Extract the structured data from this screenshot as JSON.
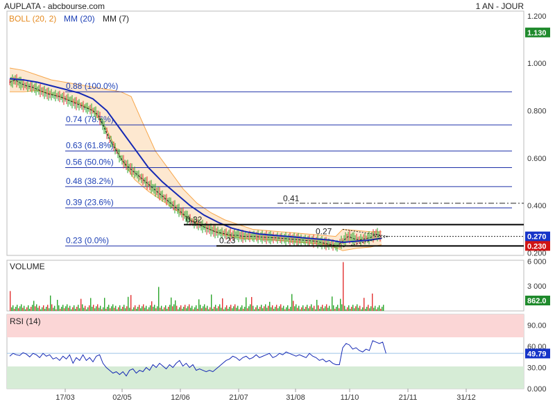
{
  "header": {
    "title": "AUPLATA - abcbourse.com",
    "period": "1 AN - JOUR"
  },
  "legend": {
    "boll": "BOLL (20, 2)",
    "mm20": "MM (20)",
    "mm7": "MM (7)"
  },
  "colors": {
    "boll": "#f7a64a",
    "bollFill": "#fde4c8",
    "mm20": "#1428b4",
    "price_up": "#2aa52a",
    "price_down": "#e23030",
    "fibo": "#1c2fa8",
    "badge_green": "#1f8a2c",
    "badge_red": "#d01414",
    "badge_blue": "#1634c8",
    "rsi_top": "#fbd6d6",
    "rsi_bottom": "#d6ecd6"
  },
  "chart_data": [
    {
      "type": "line",
      "name": "price",
      "x_ticks": [
        "17/03",
        "02/05",
        "12/06",
        "21/07",
        "31/08",
        "11/10",
        "21/11",
        "31/12"
      ],
      "y_ticks": [
        "1.200",
        "1.000",
        "0.800",
        "0.600",
        "0.400",
        "0.200"
      ],
      "ylim": [
        0.19,
        1.22
      ],
      "price_path": [
        [
          0,
          0.92
        ],
        [
          8,
          0.93
        ],
        [
          16,
          0.915
        ],
        [
          24,
          0.905
        ],
        [
          32,
          0.9
        ],
        [
          40,
          0.89
        ],
        [
          48,
          0.88
        ],
        [
          56,
          0.87
        ],
        [
          64,
          0.865
        ],
        [
          72,
          0.86
        ],
        [
          80,
          0.85
        ],
        [
          88,
          0.84
        ],
        [
          96,
          0.83
        ],
        [
          104,
          0.82
        ],
        [
          112,
          0.81
        ],
        [
          120,
          0.8
        ],
        [
          128,
          0.78
        ],
        [
          136,
          0.73
        ],
        [
          144,
          0.68
        ],
        [
          152,
          0.64
        ],
        [
          160,
          0.6
        ],
        [
          168,
          0.57
        ],
        [
          176,
          0.55
        ],
        [
          184,
          0.53
        ],
        [
          192,
          0.51
        ],
        [
          200,
          0.49
        ],
        [
          208,
          0.47
        ],
        [
          216,
          0.45
        ],
        [
          224,
          0.43
        ],
        [
          232,
          0.41
        ],
        [
          240,
          0.39
        ],
        [
          248,
          0.37
        ],
        [
          256,
          0.35
        ],
        [
          264,
          0.33
        ],
        [
          272,
          0.32
        ],
        [
          280,
          0.31
        ],
        [
          288,
          0.3
        ],
        [
          296,
          0.29
        ],
        [
          304,
          0.285
        ],
        [
          312,
          0.28
        ],
        [
          320,
          0.275
        ],
        [
          328,
          0.275
        ],
        [
          336,
          0.27
        ],
        [
          344,
          0.27
        ],
        [
          352,
          0.27
        ],
        [
          360,
          0.268
        ],
        [
          368,
          0.266
        ],
        [
          376,
          0.265
        ],
        [
          384,
          0.264
        ],
        [
          392,
          0.262
        ],
        [
          400,
          0.26
        ],
        [
          408,
          0.258
        ],
        [
          416,
          0.256
        ],
        [
          424,
          0.254
        ],
        [
          432,
          0.252
        ],
        [
          440,
          0.25
        ],
        [
          448,
          0.245
        ],
        [
          456,
          0.24
        ],
        [
          464,
          0.235
        ],
        [
          472,
          0.23
        ],
        [
          480,
          0.25
        ],
        [
          488,
          0.27
        ],
        [
          496,
          0.26
        ],
        [
          504,
          0.255
        ],
        [
          512,
          0.26
        ],
        [
          520,
          0.265
        ],
        [
          528,
          0.28
        ],
        [
          536,
          0.27
        ]
      ],
      "mm20_path": [
        [
          0,
          0.935
        ],
        [
          20,
          0.93
        ],
        [
          40,
          0.92
        ],
        [
          60,
          0.905
        ],
        [
          80,
          0.89
        ],
        [
          100,
          0.875
        ],
        [
          120,
          0.85
        ],
        [
          140,
          0.8
        ],
        [
          160,
          0.72
        ],
        [
          180,
          0.64
        ],
        [
          200,
          0.56
        ],
        [
          220,
          0.5
        ],
        [
          240,
          0.45
        ],
        [
          260,
          0.4
        ],
        [
          280,
          0.36
        ],
        [
          300,
          0.33
        ],
        [
          320,
          0.305
        ],
        [
          340,
          0.29
        ],
        [
          360,
          0.28
        ],
        [
          380,
          0.275
        ],
        [
          400,
          0.27
        ],
        [
          420,
          0.265
        ],
        [
          440,
          0.26
        ],
        [
          460,
          0.255
        ],
        [
          480,
          0.245
        ],
        [
          500,
          0.25
        ],
        [
          520,
          0.255
        ],
        [
          536,
          0.262
        ]
      ],
      "boll_upper": [
        [
          0,
          0.98
        ],
        [
          20,
          0.97
        ],
        [
          40,
          0.95
        ],
        [
          60,
          0.93
        ],
        [
          80,
          0.92
        ],
        [
          100,
          0.91
        ],
        [
          120,
          0.9
        ],
        [
          140,
          0.89
        ],
        [
          160,
          0.88
        ],
        [
          175,
          0.86
        ],
        [
          190,
          0.76
        ],
        [
          210,
          0.63
        ],
        [
          230,
          0.55
        ],
        [
          250,
          0.47
        ],
        [
          270,
          0.41
        ],
        [
          290,
          0.37
        ],
        [
          310,
          0.34
        ],
        [
          330,
          0.32
        ],
        [
          350,
          0.3
        ],
        [
          370,
          0.295
        ],
        [
          390,
          0.29
        ],
        [
          410,
          0.285
        ],
        [
          430,
          0.28
        ],
        [
          450,
          0.275
        ],
        [
          470,
          0.27
        ],
        [
          480,
          0.3
        ],
        [
          500,
          0.295
        ],
        [
          520,
          0.29
        ],
        [
          536,
          0.29
        ]
      ],
      "boll_lower": [
        [
          0,
          0.88
        ],
        [
          20,
          0.88
        ],
        [
          40,
          0.885
        ],
        [
          60,
          0.87
        ],
        [
          80,
          0.85
        ],
        [
          100,
          0.83
        ],
        [
          120,
          0.8
        ],
        [
          140,
          0.72
        ],
        [
          160,
          0.6
        ],
        [
          180,
          0.51
        ],
        [
          200,
          0.46
        ],
        [
          220,
          0.42
        ],
        [
          240,
          0.38
        ],
        [
          260,
          0.34
        ],
        [
          280,
          0.31
        ],
        [
          300,
          0.285
        ],
        [
          320,
          0.27
        ],
        [
          340,
          0.26
        ],
        [
          360,
          0.258
        ],
        [
          380,
          0.255
        ],
        [
          400,
          0.25
        ],
        [
          420,
          0.245
        ],
        [
          440,
          0.24
        ],
        [
          460,
          0.235
        ],
        [
          480,
          0.21
        ],
        [
          500,
          0.22
        ],
        [
          520,
          0.225
        ],
        [
          536,
          0.235
        ]
      ],
      "fibonacci": [
        {
          "level": "0.88",
          "label": "(100.0%)",
          "value": 0.88
        },
        {
          "level": "0.74",
          "label": "(78.6%)",
          "value": 0.74
        },
        {
          "level": "0.63",
          "label": "(61.8%)",
          "value": 0.63
        },
        {
          "level": "0.56",
          "label": "(50.0%)",
          "value": 0.56
        },
        {
          "level": "0.48",
          "label": "(38.2%)",
          "value": 0.48
        },
        {
          "level": "0.39",
          "label": "(23.6%)",
          "value": 0.39
        },
        {
          "level": "0.23",
          "label": "(0.0%)",
          "value": 0.23
        }
      ],
      "annotations": [
        {
          "text": "0.41",
          "value": 0.41
        },
        {
          "text": "0.32",
          "value": 0.32
        },
        {
          "text": "0.27",
          "value": 0.27
        },
        {
          "text": "0.23",
          "value": 0.23
        }
      ],
      "badges": [
        {
          "text": "1.130",
          "color": "#1f8a2c",
          "value": 1.13
        },
        {
          "text": "0.270",
          "color": "#1634c8",
          "value": 0.27
        },
        {
          "text": "0.230",
          "color": "#d01414",
          "value": 0.23
        }
      ]
    },
    {
      "type": "bar",
      "name": "volume",
      "title": "VOLUME",
      "y_ticks": [
        "6 000",
        "3 000"
      ],
      "ylim": [
        0,
        6000
      ],
      "current_badge": "862.0"
    },
    {
      "type": "line",
      "name": "rsi",
      "title": "RSI (14)",
      "y_ticks": [
        "90.00",
        "60.00",
        "30.00",
        "0.000"
      ],
      "ylim": [
        0,
        100
      ],
      "current_badge": "49.79",
      "values": [
        46,
        50,
        48,
        47,
        51,
        49,
        45,
        50,
        48,
        44,
        50,
        46,
        48,
        42,
        44,
        40,
        46,
        42,
        48,
        36,
        44,
        40,
        48,
        40,
        44,
        38,
        46,
        48,
        36,
        30,
        26,
        22,
        24,
        20,
        24,
        18,
        26,
        28,
        22,
        26,
        24,
        30,
        26,
        34,
        30,
        36,
        32,
        28,
        34,
        30,
        36,
        40,
        32,
        36,
        30,
        34,
        26,
        28,
        26,
        24,
        26,
        24,
        28,
        32,
        36,
        40,
        42,
        46,
        44,
        40,
        44,
        46,
        42,
        44,
        48,
        44,
        46,
        48,
        50,
        44,
        46,
        50,
        48,
        52,
        50,
        48,
        46,
        48,
        46,
        44,
        50,
        46,
        44,
        40,
        42,
        38,
        40,
        36,
        34,
        34,
        58,
        64,
        62,
        56,
        58,
        54,
        52,
        56,
        54,
        68,
        66,
        64,
        66,
        50
      ]
    }
  ]
}
